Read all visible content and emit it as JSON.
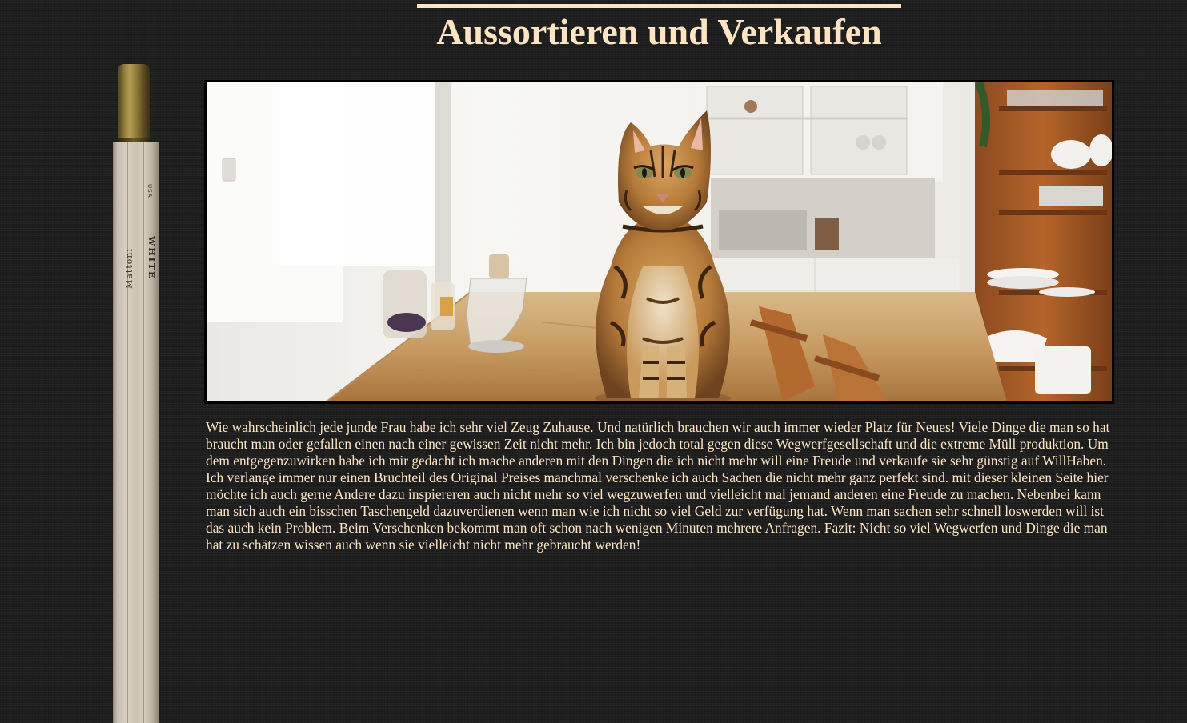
{
  "page": {
    "title": "Aussortieren und Verkaufen"
  },
  "hero_image": {
    "subject": "tabby cat sitting on a wooden kitchen table"
  },
  "article": {
    "text": "Wie wahrscheinlich jede junde Frau habe ich sehr viel Zeug Zuhause. Und natürlich brauchen wir auch immer wieder Platz für Neues! Viele Dinge die man so hat braucht man oder gefallen einen nach einer gewissen Zeit nicht mehr. Ich bin jedoch total gegen diese Wegwerfgesellschaft und die extreme Müll produktion. Um dem entgegenzuwirken habe ich mir gedacht ich mache anderen mit den Dingen die ich nicht mehr will eine Freude und verkaufe sie sehr günstig auf WillHaben. Ich verlange immer nur einen Bruchteil des Original Preises manchmal verschenke ich auch Sachen die nicht mehr ganz perfekt sind. mit dieser kleinen Seite hier möchte ich auch gerne Andere dazu inspiereren auch nicht mehr so viel wegzuwerfen und vielleicht mal jemand anderen eine Freude zu machen. Nebenbei kann man sich auch ein bisschen Taschengeld dazuverdienen wenn man wie ich nicht so viel Geld zur verfügung hat. Wenn man sachen sehr schnell loswerden will ist das auch kein Problem. Beim Verschenken bekommt man oft schon nach wenigen Minuten mehrere Anfragen. Fazit: Nicht so viel Wegwerfen und Dinge die man hat zu schätzen wissen auch wenn sie vielleicht nicht mehr gebraucht werden!"
  },
  "pencil": {
    "brand_text": "Mattoni",
    "country_text": "USA",
    "color_text": "WHITE"
  },
  "colors": {
    "background": "#1d1d1d",
    "text": "#fde5c4",
    "image_border": "#000000"
  }
}
